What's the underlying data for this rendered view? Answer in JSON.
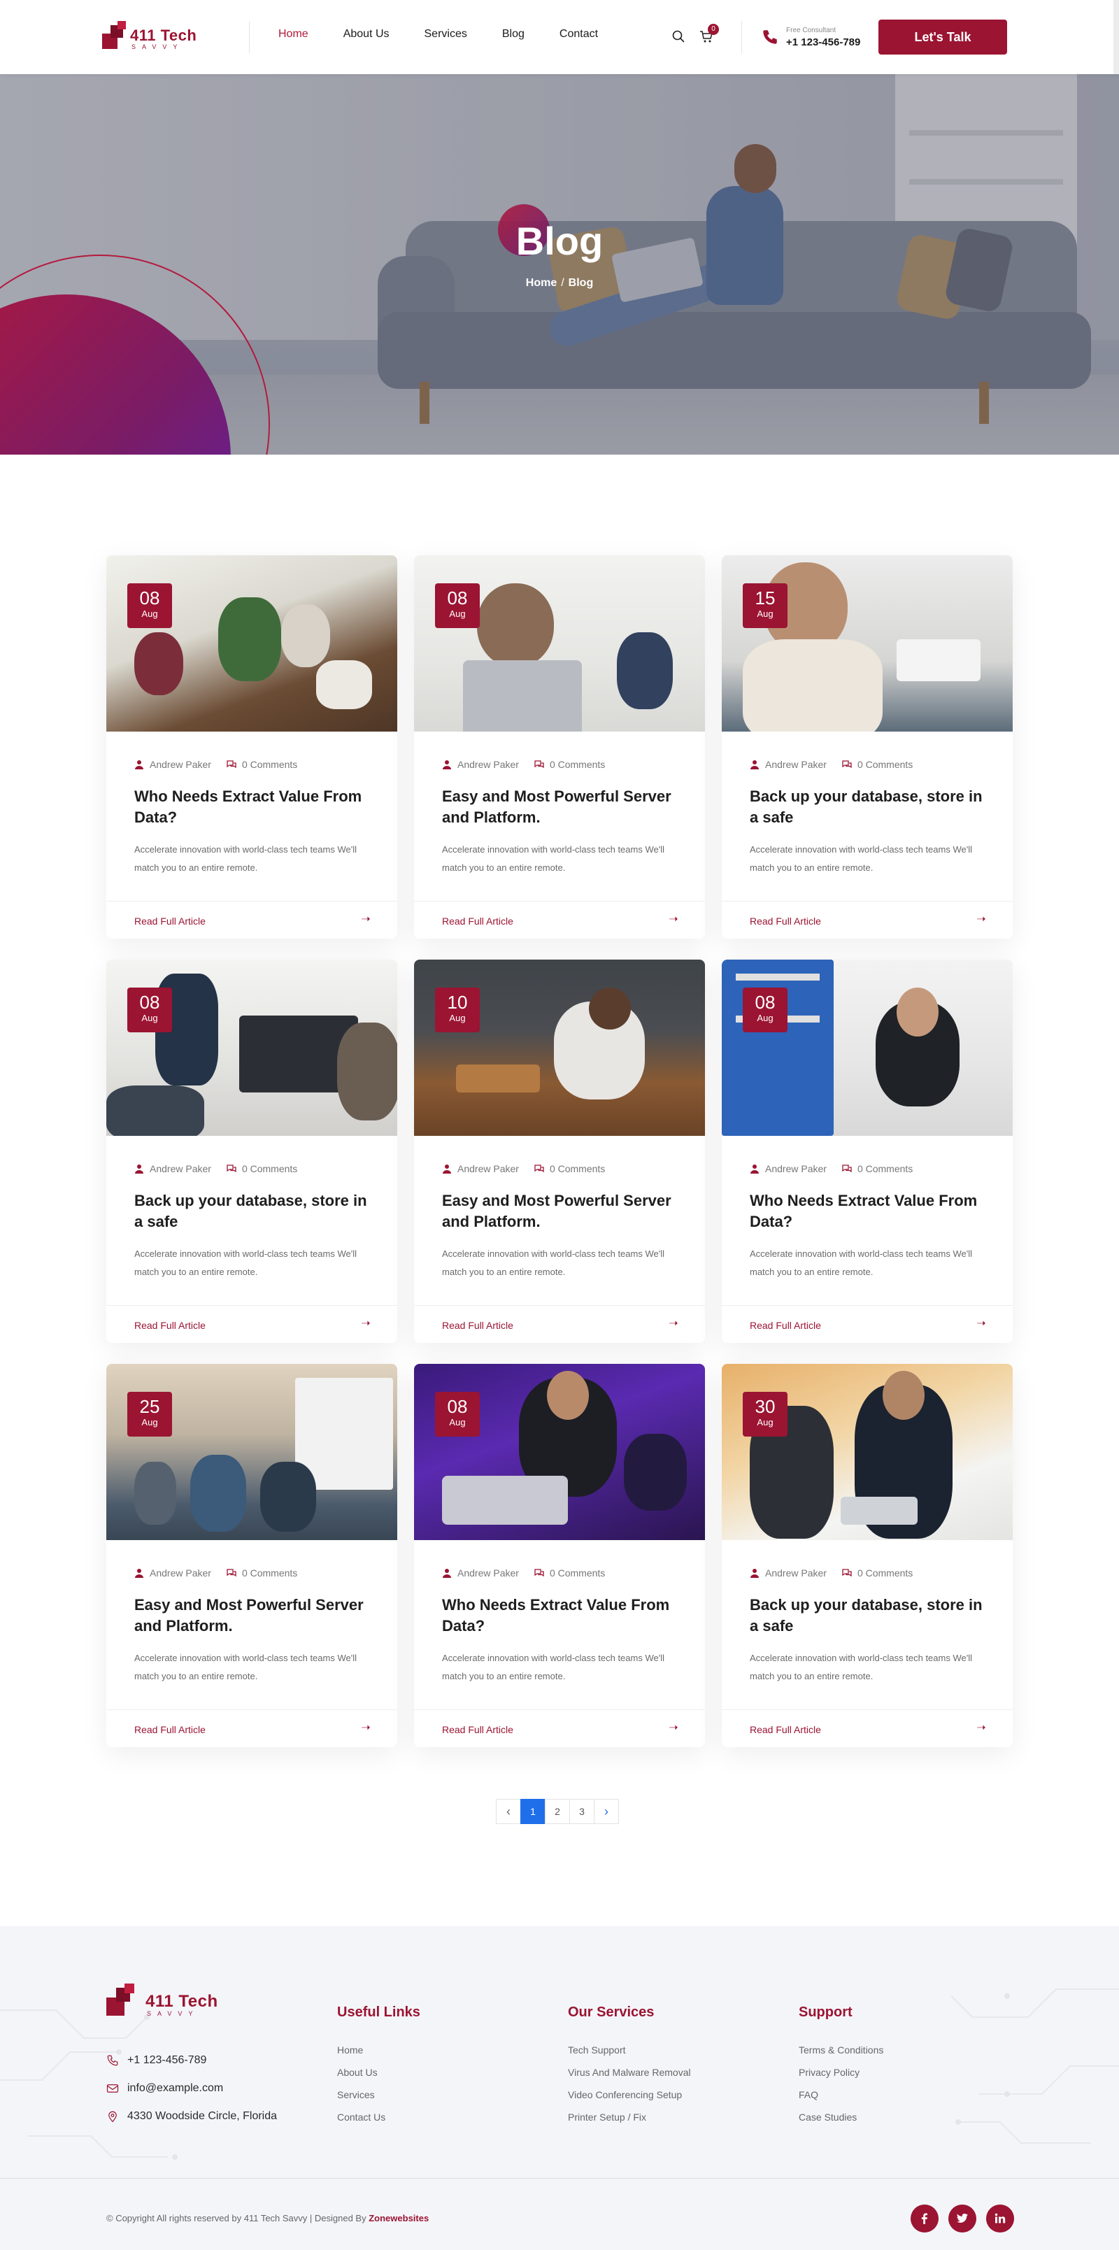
{
  "header": {
    "logo_text": "411 Tech",
    "logo_sub": "SAVVY",
    "nav": [
      {
        "label": "Home",
        "active": true
      },
      {
        "label": "About Us"
      },
      {
        "label": "Services"
      },
      {
        "label": "Blog"
      },
      {
        "label": "Contact"
      }
    ],
    "cart_count": "0",
    "consult_label": "Free Consultant",
    "consult_phone": "+1 123-456-789",
    "cta_label": "Let's Talk"
  },
  "hero": {
    "title": "Blog",
    "breadcrumb_home": "Home",
    "breadcrumb_sep": "/",
    "breadcrumb_current": "Blog"
  },
  "posts": [
    {
      "day": "08",
      "month": "Aug",
      "author": "Andrew Paker",
      "comments": "0 Comments",
      "title": "Who Needs Extract Value From Data?",
      "text": "Accelerate innovation with world-class tech teams We'll match you to an entire remote.",
      "read_more": "Read Full Article",
      "scene": "meeting-table"
    },
    {
      "day": "08",
      "month": "Aug",
      "author": "Andrew Paker",
      "comments": "0 Comments",
      "title": "Easy and Most Powerful Server and Platform.",
      "text": "Accelerate innovation with world-class tech teams We'll match you to an entire remote.",
      "read_more": "Read Full Article",
      "scene": "man-laptop"
    },
    {
      "day": "15",
      "month": "Aug",
      "author": "Andrew Paker",
      "comments": "0 Comments",
      "title": "Back up your database, store in a safe",
      "text": "Accelerate innovation with world-class tech teams We'll match you to an entire remote.",
      "read_more": "Read Full Article",
      "scene": "man-glasses"
    },
    {
      "day": "08",
      "month": "Aug",
      "author": "Andrew Paker",
      "comments": "0 Comments",
      "title": "Back up your database, store in a safe",
      "text": "Accelerate innovation with world-class tech teams We'll match you to an entire remote.",
      "read_more": "Read Full Article",
      "scene": "presentation"
    },
    {
      "day": "10",
      "month": "Aug",
      "author": "Andrew Paker",
      "comments": "0 Comments",
      "title": "Easy and Most Powerful Server and Platform.",
      "text": "Accelerate innovation with world-class tech teams We'll match you to an entire remote.",
      "read_more": "Read Full Article",
      "scene": "cafe"
    },
    {
      "day": "08",
      "month": "Aug",
      "author": "Andrew Paker",
      "comments": "0 Comments",
      "title": "Who Needs Extract Value From Data?",
      "text": "Accelerate innovation with world-class tech teams We'll match you to an entire remote.",
      "read_more": "Read Full Article",
      "scene": "workshop"
    },
    {
      "day": "25",
      "month": "Aug",
      "author": "Andrew Paker",
      "comments": "0 Comments",
      "title": "Easy and Most Powerful Server and Platform.",
      "text": "Accelerate innovation with world-class tech teams We'll match you to an entire remote.",
      "read_more": "Read Full Article",
      "scene": "open-office"
    },
    {
      "day": "08",
      "month": "Aug",
      "author": "Andrew Paker",
      "comments": "0 Comments",
      "title": "Who Needs Extract Value From Data?",
      "text": "Accelerate innovation with world-class tech teams We'll match you to an entire remote.",
      "read_more": "Read Full Article",
      "scene": "hackathon"
    },
    {
      "day": "30",
      "month": "Aug",
      "author": "Andrew Paker",
      "comments": "0 Comments",
      "title": "Back up your database, store in a safe",
      "text": "Accelerate innovation with world-class tech teams We'll match you to an entire remote.",
      "read_more": "Read Full Article",
      "scene": "tablet-meeting"
    }
  ],
  "pagination": {
    "pages": [
      "1",
      "2",
      "3"
    ],
    "current": "1",
    "prev_icon": "chevron-left-icon",
    "next_icon": "chevron-right-icon"
  },
  "footer": {
    "logo_text": "411 Tech",
    "logo_sub": "SAVVY",
    "phone": "+1 123-456-789",
    "email": "info@example.com",
    "address": "4330 Woodside Circle, Florida",
    "columns": [
      {
        "title": "Useful Links",
        "links": [
          "Home",
          "About Us",
          "Services",
          "Contact Us"
        ]
      },
      {
        "title": "Our Services",
        "links": [
          "Tech Support",
          "Virus And Malware Removal",
          "Video Conferencing Setup",
          "Printer Setup / Fix"
        ]
      },
      {
        "title": "Support",
        "links": [
          "Terms & Conditions",
          "Privacy Policy",
          "FAQ",
          "Case Studies"
        ]
      }
    ],
    "copyright": "© Copyright All rights reserved by 411 Tech Savvy | Designed By",
    "designer": "Zonewebsites",
    "socials": [
      "facebook-icon",
      "twitter-icon",
      "linkedin-icon"
    ]
  },
  "colors": {
    "brand": "#9b1432",
    "pager_active": "#1f6feb",
    "footer_bg": "#f4f5f9"
  }
}
